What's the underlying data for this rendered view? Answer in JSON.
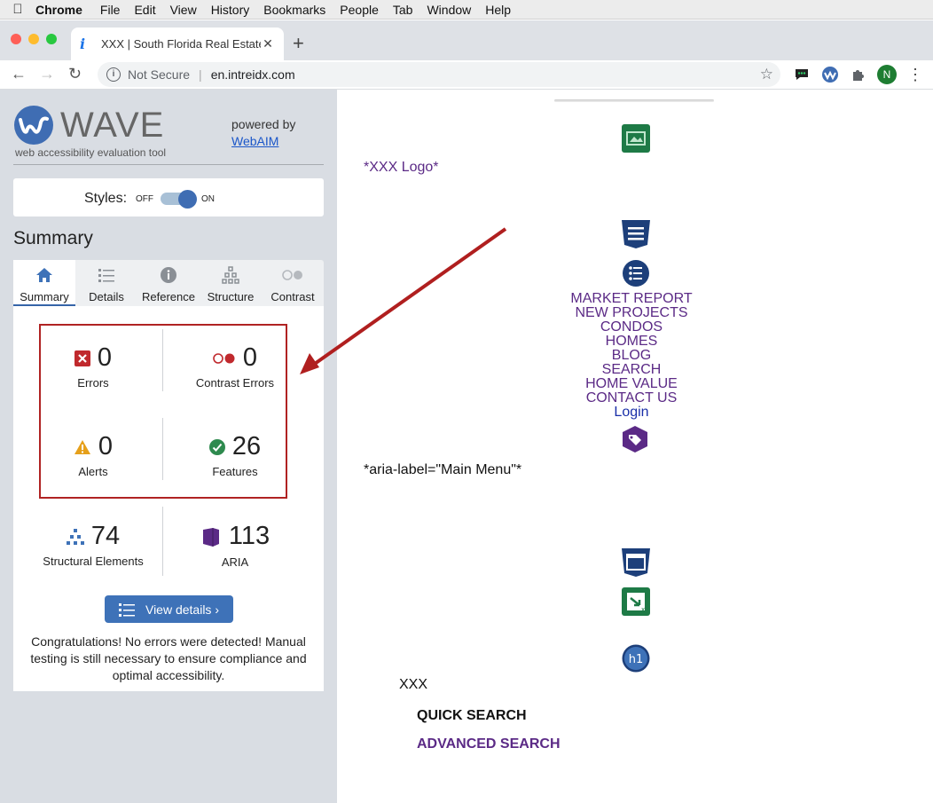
{
  "menubar": {
    "app": "Chrome",
    "items": [
      "File",
      "Edit",
      "View",
      "History",
      "Bookmarks",
      "People",
      "Tab",
      "Window",
      "Help"
    ]
  },
  "browser": {
    "tab_title": "XXX | South Florida Real Estate",
    "security": "Not Secure",
    "url": "en.intreidx.com",
    "profile_initial": "N"
  },
  "wave": {
    "logo_word": "WAVE",
    "subtitle": "web accessibility evaluation tool",
    "powered_by": "powered by",
    "webaim": "WebAIM",
    "styles_label": "Styles:",
    "styles_off": "OFF",
    "styles_on": "ON",
    "styles_enabled": true,
    "heading": "Summary",
    "tabs": [
      {
        "label": "Summary",
        "icon": "home-icon",
        "active": true
      },
      {
        "label": "Details",
        "icon": "list-icon",
        "active": false
      },
      {
        "label": "Reference",
        "icon": "info-icon",
        "active": false
      },
      {
        "label": "Structure",
        "icon": "hierarchy-icon",
        "active": false
      },
      {
        "label": "Contrast",
        "icon": "contrast-icon",
        "active": false
      }
    ],
    "stats": {
      "errors": {
        "value": "0",
        "label": "Errors"
      },
      "contrast": {
        "value": "0",
        "label": "Contrast Errors"
      },
      "alerts": {
        "value": "0",
        "label": "Alerts"
      },
      "features": {
        "value": "26",
        "label": "Features"
      },
      "structural": {
        "value": "74",
        "label": "Structural Elements"
      },
      "aria": {
        "value": "113",
        "label": "ARIA"
      }
    },
    "view_details": "View details ›",
    "congrats": "Congratulations! No errors were detected! Manual testing is still necessary to ensure compliance and optimal accessibility."
  },
  "page": {
    "logo_alt": "*XXX Logo*",
    "menu": [
      "MARKET REPORT",
      "NEW PROJECTS",
      "CONDOS",
      "HOMES",
      "BLOG",
      "SEARCH",
      "HOME VALUE",
      "CONTACT US"
    ],
    "login": "Login",
    "aria_label": "*aria-label=\"Main Menu\"*",
    "h1_text": "XXX",
    "quick_search": "QUICK SEARCH",
    "advanced_search": "ADVANCED SEARCH"
  },
  "colors": {
    "wave_blue": "#3e72b8",
    "annotation_red": "#b02323",
    "page_purple": "#5b2a86"
  }
}
